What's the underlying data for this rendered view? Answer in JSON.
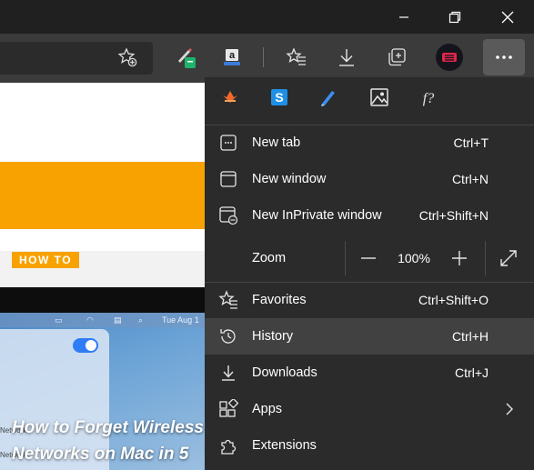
{
  "window": {
    "controls": [
      "minimize-icon",
      "restore-icon",
      "close-icon"
    ]
  },
  "toolbar": {
    "icons": [
      "favorite-add-icon",
      "extension-pen-icon",
      "extension-amazon-icon",
      "favorites-icon",
      "downloads-icon",
      "collections-icon",
      "profile-icon",
      "more-icon"
    ]
  },
  "page": {
    "badge": "HOW TO",
    "headline": "How to Forget Wireless Networks on Mac in 5",
    "mac_date": "Tue Aug 1",
    "panel_texts": [
      "Network",
      "Network"
    ]
  },
  "menu": {
    "extensions": [
      "extension-orange-icon",
      "extension-s-icon",
      "extension-pencil-icon",
      "extension-image-icon",
      "extension-fx-icon"
    ],
    "new_tab": {
      "label": "New tab",
      "shortcut": "Ctrl+T"
    },
    "new_window": {
      "label": "New window",
      "shortcut": "Ctrl+N"
    },
    "new_inprivate": {
      "label": "New InPrivate window",
      "shortcut": "Ctrl+Shift+N"
    },
    "zoom": {
      "label": "Zoom",
      "value": "100%"
    },
    "favorites": {
      "label": "Favorites",
      "shortcut": "Ctrl+Shift+O"
    },
    "history": {
      "label": "History",
      "shortcut": "Ctrl+H"
    },
    "downloads": {
      "label": "Downloads",
      "shortcut": "Ctrl+J"
    },
    "apps": {
      "label": "Apps"
    },
    "extensions_item": {
      "label": "Extensions"
    }
  },
  "colors": {
    "accent_orange": "#f7a200",
    "menu_bg": "#2b2b2b",
    "hover_bg": "#414141",
    "toolbar_bg": "#3b3b3b"
  }
}
